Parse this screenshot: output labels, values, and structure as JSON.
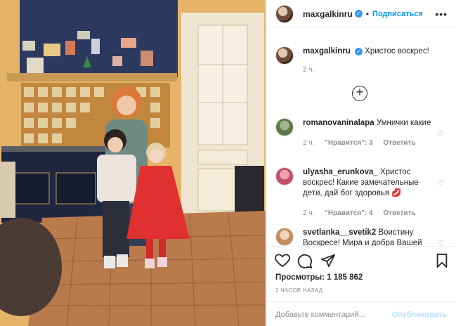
{
  "post": {
    "username": "maxgalkinru",
    "follow_label": "Подписаться",
    "separator": "•",
    "more_icon": "more-dots-icon",
    "verified_icon": "verified-badge-icon"
  },
  "caption": {
    "username": "maxgalkinru",
    "text": "Христос воскрес!",
    "time": "2 ч."
  },
  "load_more_icon": "plus-circle-icon",
  "comments": [
    {
      "username": "romanovaninalapa",
      "text": "Умнички какие",
      "time": "2 ч.",
      "likes": "\"Нравится\": 3",
      "reply": "Ответить"
    },
    {
      "username": "ulyasha_erunkova_",
      "text": "Христос воскрес! Какие замечательные дети, дай бог здоровья 💋",
      "time": "2 ч.",
      "likes": "\"Нравится\": 4",
      "reply": "Ответить"
    },
    {
      "username": "svetlanka__svetik2",
      "text": "Воистину Воскресе! Мира и добра Вашей",
      "time": "",
      "likes": "",
      "reply": ""
    }
  ],
  "actions": {
    "like_icon": "heart-icon",
    "comment_icon": "comment-icon",
    "share_icon": "share-icon",
    "save_icon": "bookmark-icon"
  },
  "views": {
    "label": "Просмотры:",
    "count": "1 185 862"
  },
  "posted_ago": "2 ЧАСОВ НАЗАД",
  "comment_box": {
    "placeholder": "Добавьте комментарий...",
    "publish_label": "Опубликовать"
  },
  "colors": {
    "accent": "#0095f6",
    "verified": "#3897f0",
    "muted": "#8e8e8e"
  }
}
